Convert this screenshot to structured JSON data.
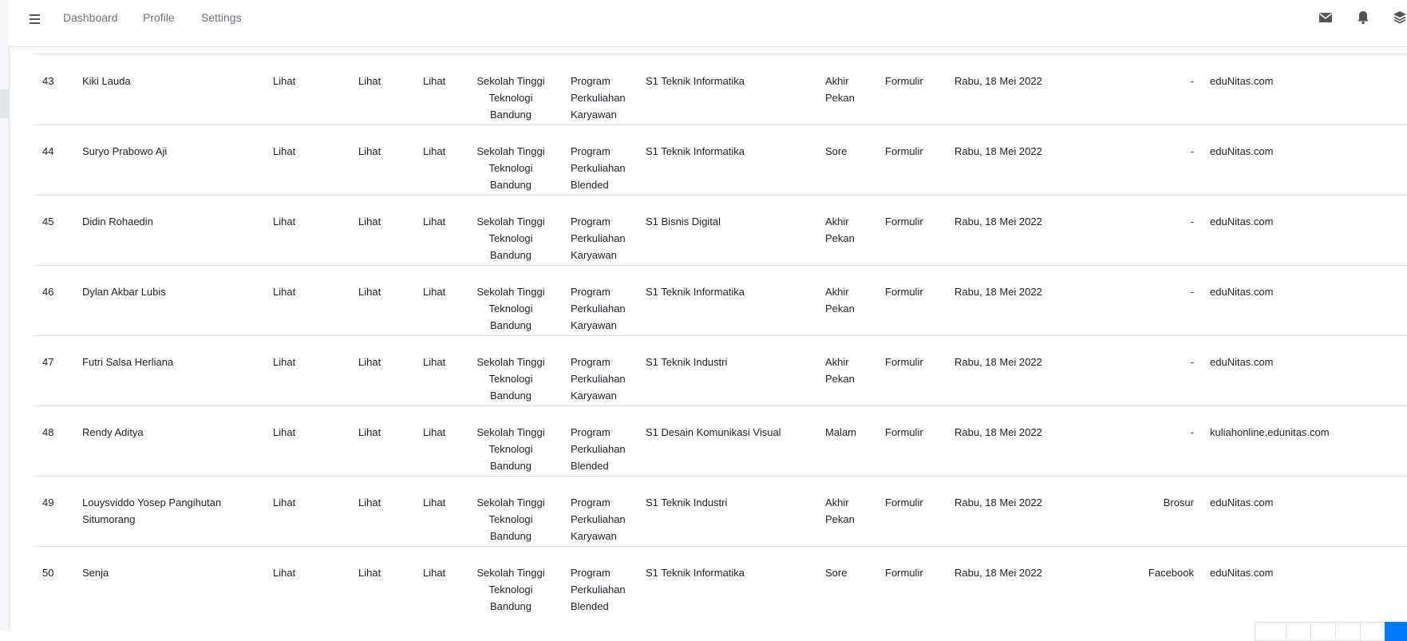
{
  "navbar": {
    "links": [
      "Dashboard",
      "Profile",
      "Settings"
    ],
    "icons": [
      "envelope-icon",
      "bell-icon",
      "layers-icon"
    ]
  },
  "colors": {
    "accent": "#007bff",
    "border": "#dee2e6",
    "nav_text": "#6c757d"
  },
  "table": {
    "rows": [
      {
        "no": "43",
        "name": "Kiki Lauda",
        "lihat1": "Lihat",
        "lihat2": "Lihat",
        "lihat3": "Lihat",
        "campus": "Sekolah Tinggi Teknologi Bandung",
        "program": "Program Perkuliahan Karyawan",
        "major": "S1 Teknik Informatika",
        "class_time": "Akhir Pekan",
        "source": "Formulir",
        "date": "Rabu, 18 Mei 2022",
        "reference": "-",
        "site": "eduNitas.com"
      },
      {
        "no": "44",
        "name": "Suryo Prabowo Aji",
        "lihat1": "Lihat",
        "lihat2": "Lihat",
        "lihat3": "Lihat",
        "campus": "Sekolah Tinggi Teknologi Bandung",
        "program": "Program Perkuliahan Blended",
        "major": "S1 Teknik Informatika",
        "class_time": "Sore",
        "source": "Formulir",
        "date": "Rabu, 18 Mei 2022",
        "reference": "-",
        "site": "eduNitas.com"
      },
      {
        "no": "45",
        "name": "Didin Rohaedin",
        "lihat1": "Lihat",
        "lihat2": "Lihat",
        "lihat3": "Lihat",
        "campus": "Sekolah Tinggi Teknologi Bandung",
        "program": "Program Perkuliahan Karyawan",
        "major": "S1 Bisnis Digital",
        "class_time": "Akhir Pekan",
        "source": "Formulir",
        "date": "Rabu, 18 Mei 2022",
        "reference": "-",
        "site": "eduNitas.com"
      },
      {
        "no": "46",
        "name": "Dylan Akbar Lubis",
        "lihat1": "Lihat",
        "lihat2": "Lihat",
        "lihat3": "Lihat",
        "campus": "Sekolah Tinggi Teknologi Bandung",
        "program": "Program Perkuliahan Karyawan",
        "major": "S1 Teknik Informatika",
        "class_time": "Akhir Pekan",
        "source": "Formulir",
        "date": "Rabu, 18 Mei 2022",
        "reference": "-",
        "site": "eduNitas.com"
      },
      {
        "no": "47",
        "name": "Futri Salsa Herliana",
        "lihat1": "Lihat",
        "lihat2": "Lihat",
        "lihat3": "Lihat",
        "campus": "Sekolah Tinggi Teknologi Bandung",
        "program": "Program Perkuliahan Karyawan",
        "major": "S1 Teknik Industri",
        "class_time": "Akhir Pekan",
        "source": "Formulir",
        "date": "Rabu, 18 Mei 2022",
        "reference": "-",
        "site": "eduNitas.com"
      },
      {
        "no": "48",
        "name": "Rendy Aditya",
        "lihat1": "Lihat",
        "lihat2": "Lihat",
        "lihat3": "Lihat",
        "campus": "Sekolah Tinggi Teknologi Bandung",
        "program": "Program Perkuliahan Blended",
        "major": "S1 Desain Komunikasi Visual",
        "class_time": "Malam",
        "source": "Formulir",
        "date": "Rabu, 18 Mei 2022",
        "reference": "-",
        "site": "kuliahonline.edunitas.com"
      },
      {
        "no": "49",
        "name": "Louysviddo Yosep Pangihutan Situmorang",
        "lihat1": "Lihat",
        "lihat2": "Lihat",
        "lihat3": "Lihat",
        "campus": "Sekolah Tinggi Teknologi Bandung",
        "program": "Program Perkuliahan Karyawan",
        "major": "S1 Teknik Industri",
        "class_time": "Akhir Pekan",
        "source": "Formulir",
        "date": "Rabu, 18 Mei 2022",
        "reference": "Brosur",
        "site": "eduNitas.com"
      },
      {
        "no": "50",
        "name": "Senja",
        "lihat1": "Lihat",
        "lihat2": "Lihat",
        "lihat3": "Lihat",
        "campus": "Sekolah Tinggi Teknologi Bandung",
        "program": "Program Perkuliahan Blended",
        "major": "S1 Teknik Informatika",
        "class_time": "Sore",
        "source": "Formulir",
        "date": "Rabu, 18 Mei 2022",
        "reference": "Facebook",
        "site": "eduNitas.com"
      }
    ]
  }
}
